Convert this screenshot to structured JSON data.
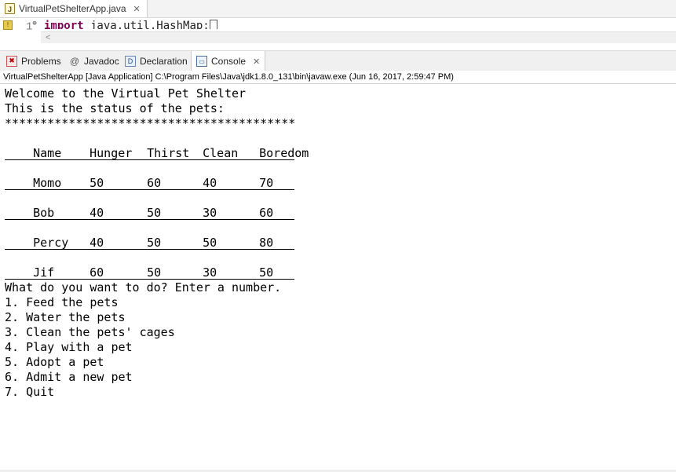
{
  "editor": {
    "tab_title": "VirtualPetShelterApp.java",
    "line_number": "1",
    "code_keyword": "import",
    "code_rest": " java.util.HashMap;",
    "scroll_arrow": "<"
  },
  "views": {
    "tabs": [
      {
        "label": "Problems",
        "icon": "problems-icon"
      },
      {
        "label": "Javadoc",
        "icon": "javadoc-icon"
      },
      {
        "label": "Declaration",
        "icon": "declaration-icon"
      },
      {
        "label": "Console",
        "icon": "console-icon"
      }
    ],
    "active_tab": "Console"
  },
  "console": {
    "header": "VirtualPetShelterApp [Java Application] C:\\Program Files\\Java\\jdk1.8.0_131\\bin\\javaw.exe (Jun 16, 2017, 2:59:47 PM)",
    "welcome": "Welcome to the Virtual Pet Shelter",
    "status_intro": "This is the status of the pets:",
    "stars": "*****************************************",
    "table": {
      "headers": [
        "Name",
        "Hunger",
        "Thirst",
        "Clean",
        "Boredom"
      ],
      "rows": [
        [
          "Momo",
          "50",
          "60",
          "40",
          "70"
        ],
        [
          "Bob",
          "40",
          "50",
          "30",
          "60"
        ],
        [
          "Percy",
          "40",
          "50",
          "50",
          "80"
        ],
        [
          "Jif",
          "60",
          "50",
          "30",
          "50"
        ]
      ]
    },
    "prompt": "What do you want to do? Enter a number.",
    "menu": [
      "1. Feed the pets",
      "2. Water the pets",
      "3. Clean the pets' cages",
      "4. Play with a pet",
      "5. Adopt a pet",
      "6. Admit a new pet",
      "7. Quit"
    ]
  }
}
